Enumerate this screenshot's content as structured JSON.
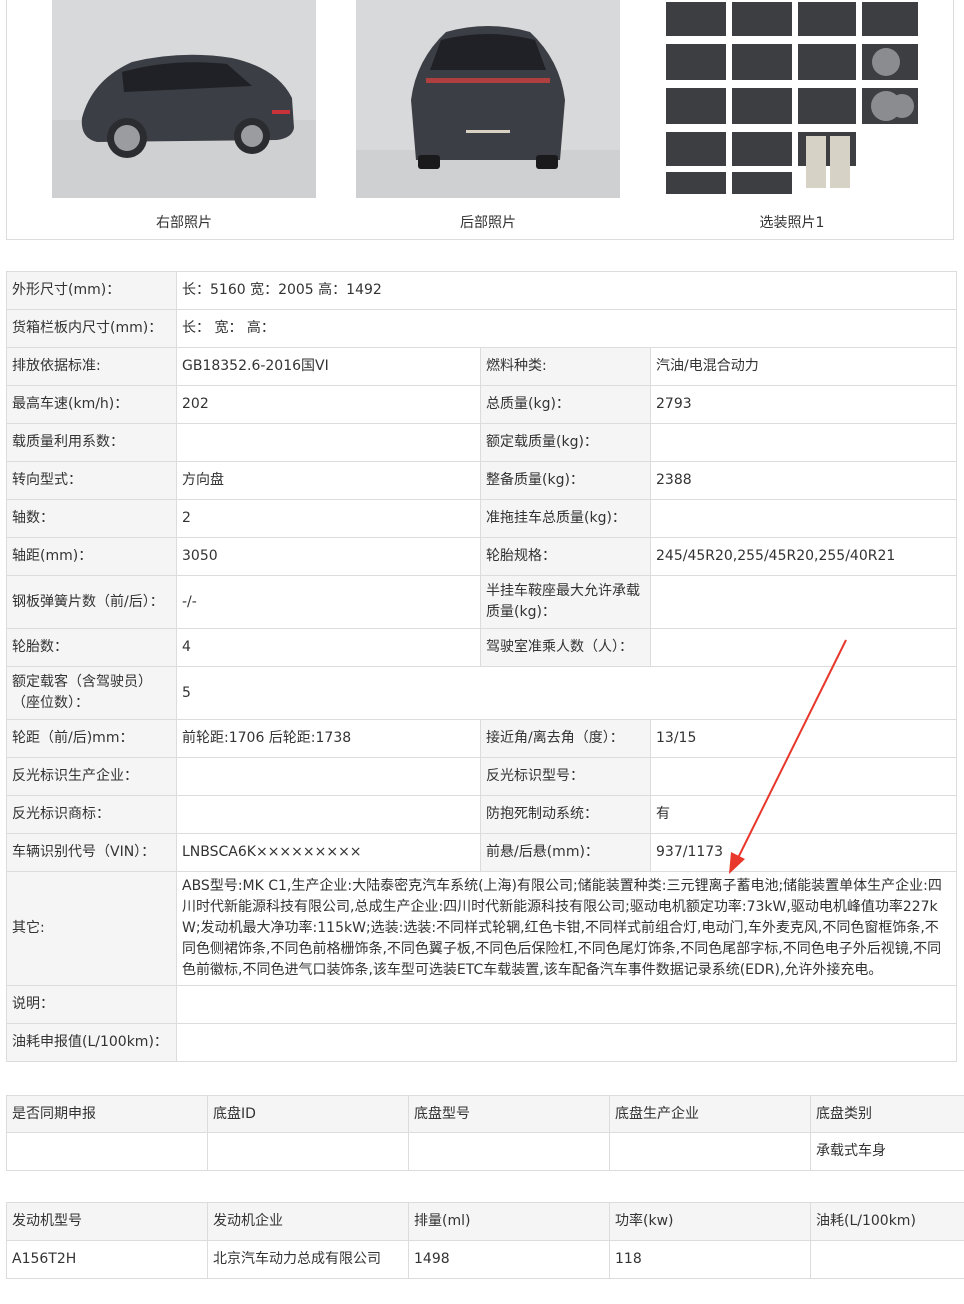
{
  "photos": [
    {
      "caption": "右部照片",
      "icon": "car-side-right-photo"
    },
    {
      "caption": "后部照片",
      "icon": "car-rear-photo"
    },
    {
      "caption": "选装照片1",
      "icon": "options-collage-photo"
    }
  ],
  "spec": {
    "r1": {
      "l": "外形尺寸(mm)：",
      "v": "长：5160 宽：2005 高：1492"
    },
    "r2": {
      "l": "货箱栏板内尺寸(mm)：",
      "v": "长： 宽： 高："
    },
    "r3": {
      "l1": "排放依据标准:",
      "v1": "GB18352.6-2016国VI",
      "l2": "燃料种类:",
      "v2": "汽油/电混合动力"
    },
    "r4": {
      "l1": "最高车速(km/h)：",
      "v1": "202",
      "l2": "总质量(kg)：",
      "v2": "2793"
    },
    "r5": {
      "l1": "载质量利用系数：",
      "v1": "",
      "l2": "额定载质量(kg)：",
      "v2": ""
    },
    "r6": {
      "l1": "转向型式：",
      "v1": "方向盘",
      "l2": "整备质量(kg)：",
      "v2": "2388"
    },
    "r7": {
      "l1": "轴数：",
      "v1": "2",
      "l2": "准拖挂车总质量(kg)：",
      "v2": ""
    },
    "r8": {
      "l1": "轴距(mm)：",
      "v1": "3050",
      "l2": "轮胎规格：",
      "v2": "245/45R20,255/45R20,255/40R21"
    },
    "r9": {
      "l1": "钢板弹簧片数（前/后）：",
      "v1": "-/-",
      "l2": "半挂车鞍座最大允许承载质量(kg)：",
      "v2": ""
    },
    "r10": {
      "l1": "轮胎数：",
      "v1": "4",
      "l2": "驾驶室准乘人数（人）：",
      "v2": ""
    },
    "r11": {
      "l1": "额定载客（含驾驶员）（座位数）：",
      "v1": "5"
    },
    "r12": {
      "l1": "轮距（前/后)mm：",
      "v1": "前轮距:1706 后轮距:1738",
      "l2": "接近角/离去角（度）：",
      "v2": "13/15"
    },
    "r13": {
      "l1": "反光标识生产企业：",
      "v1": "",
      "l2": "反光标识型号：",
      "v2": ""
    },
    "r14": {
      "l1": "反光标识商标：",
      "v1": "",
      "l2": "防抱死制动系统：",
      "v2": "有"
    },
    "r15": {
      "l1": "车辆识别代号（VIN）：",
      "v1": "LNBSCA6K×××××××××",
      "l2": "前悬/后悬(mm)：",
      "v2": "937/1173"
    },
    "r16": {
      "l": "其它:",
      "v": "ABS型号:MK C1,生产企业:大陆泰密克汽车系统(上海)有限公司;储能装置种类:三元锂离子蓄电池;储能装置单体生产企业:四川时代新能源科技有限公司,总成生产企业:四川时代新能源科技有限公司;驱动电机额定功率:73kW,驱动电机峰值功率227kW;发动机最大净功率:115kW;选装:选装:不同样式轮辋,红色卡钳,不同样式前组合灯,电动门,车外麦克风,不同色窗框饰条,不同色侧裙饰条,不同色前格栅饰条,不同色翼子板,不同色后保险杠,不同色尾灯饰条,不同色尾部字标,不同色电子外后视镜,不同色前徽标,不同色进气口装饰条,该车型可选装ETC车载装置,该车配备汽车事件数据记录系统(EDR),允许外接充电。"
    },
    "r17": {
      "l": "说明：",
      "v": ""
    },
    "r18": {
      "l": "油耗申报值(L/100km)：",
      "v": ""
    }
  },
  "chassis": {
    "headers": [
      "是否同期申报",
      "底盘ID",
      "底盘型号",
      "底盘生产企业",
      "底盘类别"
    ],
    "row": [
      "",
      "",
      "",
      "",
      "承载式车身"
    ]
  },
  "engine": {
    "headers": [
      "发动机型号",
      "发动机企业",
      "排量(ml)",
      "功率(kw)",
      "油耗(L/100km)"
    ],
    "row": [
      "A156T2H",
      "北京汽车动力总成有限公司",
      "1498",
      "118",
      ""
    ]
  },
  "annotation": {
    "color": "#e8372b",
    "icon": "red-arrow-annotation"
  }
}
